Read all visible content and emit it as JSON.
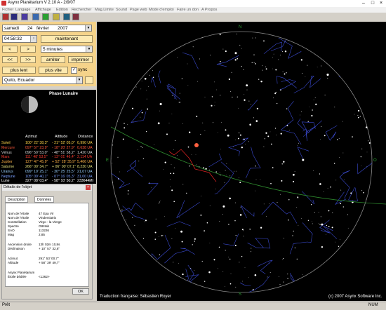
{
  "window": {
    "title": "Asynx Planétarium V 2.10 A - 2/9/07"
  },
  "menu": [
    "Fichier",
    "Langage",
    "Affichage",
    "Edition",
    "Rechercher",
    "Mag.Limite",
    "Sound",
    "Page web",
    "Mode d'emploi",
    "Faire un don",
    "A Propos"
  ],
  "controls": {
    "day_name": "samedi",
    "day": "24",
    "month": "février",
    "year": "2007",
    "time": "04:58:32",
    "now_button": "maintenant",
    "back": "<",
    "forward": ">",
    "step": "5 minutes",
    "fast_back": "<<",
    "fast_forward": ">>",
    "stop_button": "arrêter",
    "print_button": "imprimer",
    "slower_button": "plus lent",
    "faster_button": "plus vite",
    "sync_label": "sync",
    "location": "Quito, Ecuador"
  },
  "moon": {
    "label": "Phase Lunaire"
  },
  "planets": {
    "headers": {
      "azimut": "Azimut",
      "altitude": "Altitude",
      "distance": "Distance"
    },
    "rows": [
      {
        "name": "Soleil",
        "az": "100° 22' 38,3\"",
        "alt": "- 21° 52' 05,0\"",
        "dist": "0,990 UA",
        "color": "#ffd54a"
      },
      {
        "name": "Mercure",
        "az": "097° 57' 23,9\"",
        "alt": "- 18° 20' 27,9\"",
        "dist": "0,638 UA",
        "color": "#ff5a3a"
      },
      {
        "name": "Vénus",
        "az": "096° 50' 53,0\"",
        "alt": "- 48° 51' 58,2\"",
        "dist": "1,420 UA",
        "color": "#d9d9d9"
      },
      {
        "name": "Mars",
        "az": "111° 48' 53,5\"",
        "alt": "- 13° 01' 46,4\"",
        "dist": "2,114 UA",
        "color": "#ff3b2f"
      },
      {
        "name": "Jupiter",
        "az": "127° 47' 45,9\"",
        "alt": "+ 52° 28' 35,9\"",
        "dist": "5,466 UA",
        "color": "#ffb347"
      },
      {
        "name": "Saturne",
        "az": "266° 00' 34,7\"",
        "alt": "+ 06° 00' 07,1\"",
        "dist": "8,230 UA",
        "color": "#e6e07a"
      },
      {
        "name": "Uranus",
        "az": "099° 10' 25,1\"",
        "alt": "- 30° 25' 25,5\"",
        "dist": "21,07 UA",
        "color": "#9ad0ff"
      },
      {
        "name": "Neptune",
        "az": "105° 09' 40,1\"",
        "alt": "- 07° 16' 05,3\"",
        "dist": "31,00 UA",
        "color": "#7aa0ff"
      },
      {
        "name": "Lune",
        "az": "327° 08' 03,4\"",
        "alt": "- 58° 10' 50,2\"",
        "dist": "233644MI",
        "color": "#ffffff"
      }
    ]
  },
  "dialog": {
    "title": "Détails de l'objet",
    "close": "×",
    "tab_description": "Description",
    "tab_donnees": "Données",
    "rows": [
      {
        "k": "Nom de l'étoile",
        "v": "47 Epa Vir"
      },
      {
        "k": "Nom de l'étoile",
        "v": "Vindemiatrix"
      },
      {
        "k": "Constellation",
        "v": "Virgo - la Vierge"
      },
      {
        "k": "Spectre",
        "v": "G8IIIab"
      },
      {
        "k": "SAO",
        "v": "113226"
      },
      {
        "k": "Mag",
        "v": "2,85"
      },
      {
        "k": "Ascension droite",
        "v": "13h 02m 10,8s"
      },
      {
        "k": "Déclinaison",
        "v": "+ 10° 57' 32,8\""
      },
      {
        "k": "Azimut",
        "v": "291° 53' 00,7\""
      },
      {
        "k": "Altitude",
        "v": "+ 58° 39' 49,7\""
      },
      {
        "k": "Asynx Planétarium",
        "v": ""
      },
      {
        "k": "Étoile dédiée",
        "v": "<1262>"
      }
    ],
    "ok": "OK"
  },
  "sky": {
    "translation_credit": "Traduction française: Sébastien Royer",
    "copyright": "(c) 2007 Asynx Software Inc.",
    "cardinal_n": "N",
    "cardinal_s": "S",
    "cardinal_e": "E",
    "cardinal_w": "O"
  },
  "status": {
    "left": "Prêt",
    "right": "NUM"
  }
}
